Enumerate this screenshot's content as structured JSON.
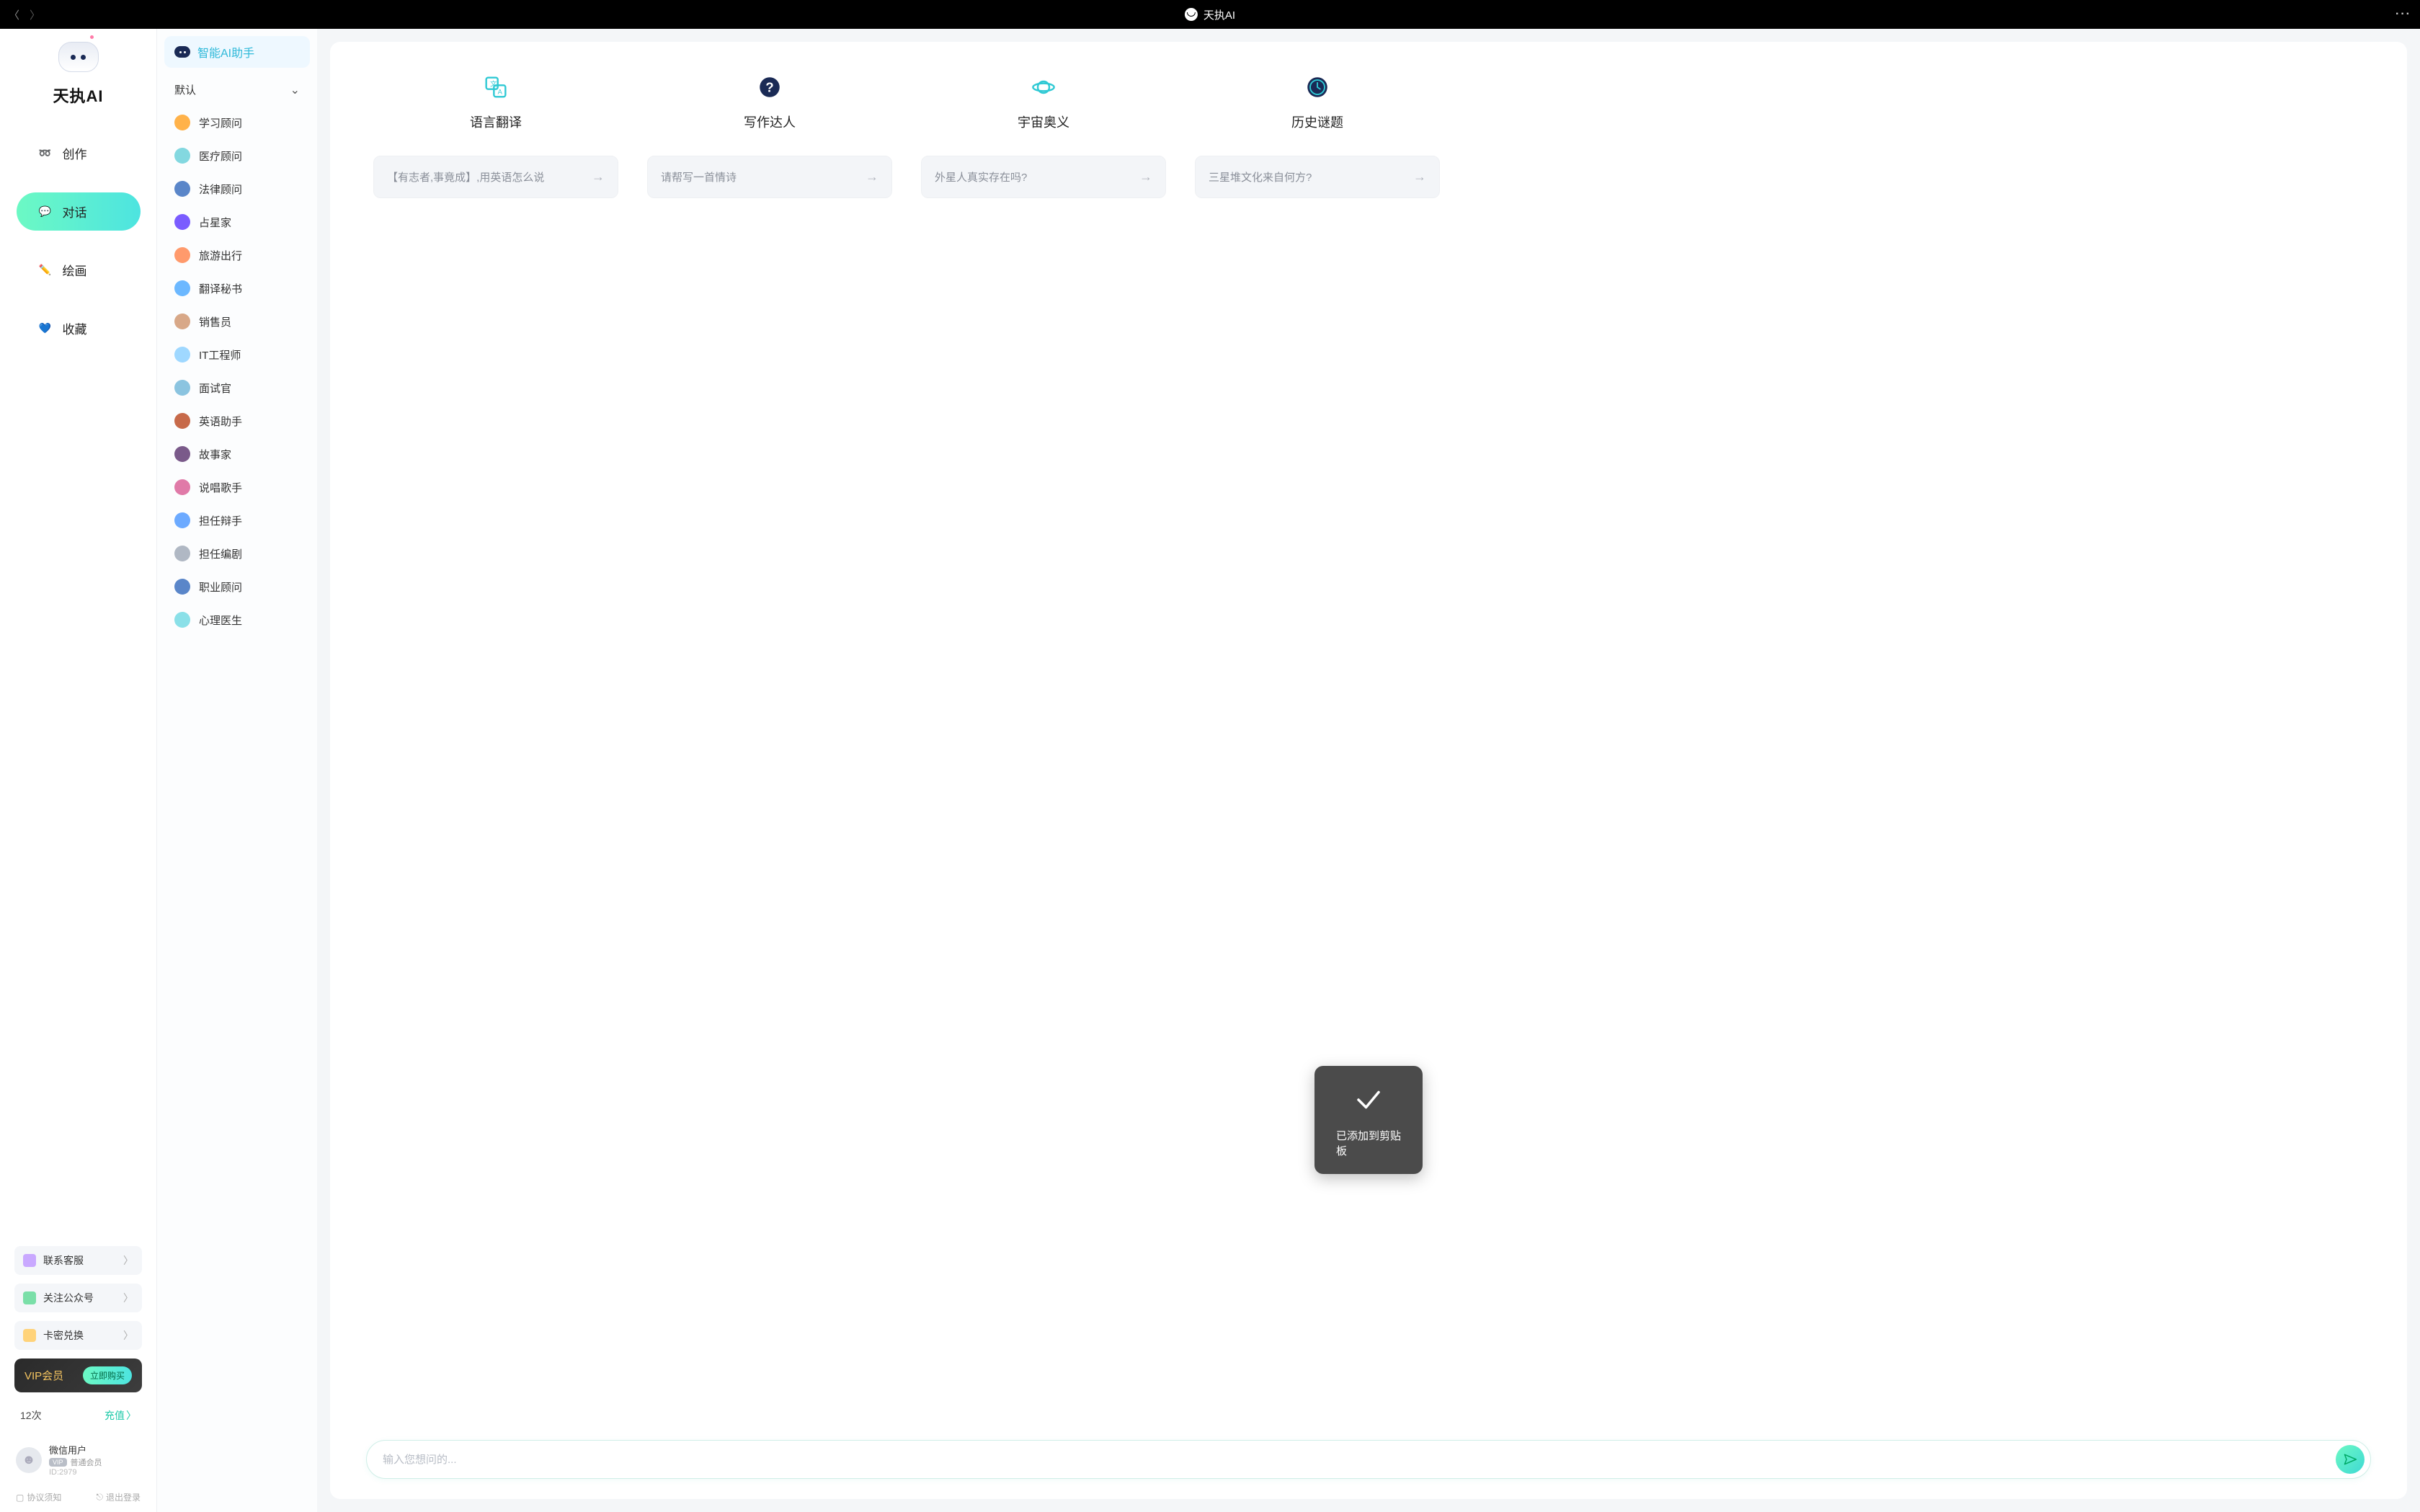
{
  "topbar": {
    "title": "天执AI"
  },
  "sidebar1": {
    "appName": "天执AI",
    "nav": [
      {
        "label": "创作",
        "icon": "➿"
      },
      {
        "label": "对话",
        "icon": "💬",
        "active": true
      },
      {
        "label": "绘画",
        "icon": "✏️"
      },
      {
        "label": "收藏",
        "icon": "💙"
      }
    ],
    "actions": [
      {
        "label": "联系客服",
        "color": "#c9a8ff"
      },
      {
        "label": "关注公众号",
        "color": "#7adfa8"
      },
      {
        "label": "卡密兑换",
        "color": "#ffd37a"
      }
    ],
    "vip": {
      "label": "VIP会员",
      "btn": "立即购买"
    },
    "credit": {
      "count": "12次",
      "recharge": "充值"
    },
    "user": {
      "name": "微信用户",
      "badge": "VIP",
      "tier": "普通会员",
      "id": "ID:2979"
    },
    "bottom": {
      "agreement": "协议须知",
      "logout": "退出登录"
    }
  },
  "sidebar2": {
    "header": "智能AI助手",
    "default": "默认",
    "roles": [
      {
        "label": "学习顾问",
        "bg": "#ffb24a"
      },
      {
        "label": "医疗顾问",
        "bg": "#83d8e0"
      },
      {
        "label": "法律顾问",
        "bg": "#5a86c9"
      },
      {
        "label": "占星家",
        "bg": "#7a5cff"
      },
      {
        "label": "旅游出行",
        "bg": "#ff9a6c"
      },
      {
        "label": "翻译秘书",
        "bg": "#6cb8ff"
      },
      {
        "label": "销售员",
        "bg": "#d8a888"
      },
      {
        "label": "IT工程师",
        "bg": "#9fd8ff"
      },
      {
        "label": "面试官",
        "bg": "#8bc4e0"
      },
      {
        "label": "英语助手",
        "bg": "#c76a4a"
      },
      {
        "label": "故事家",
        "bg": "#7a5a8a"
      },
      {
        "label": "说唱歌手",
        "bg": "#e07aa8"
      },
      {
        "label": "担任辩手",
        "bg": "#6caaff"
      },
      {
        "label": "担任编剧",
        "bg": "#b0b8c4"
      },
      {
        "label": "职业顾问",
        "bg": "#5a86c9"
      },
      {
        "label": "心理医生",
        "bg": "#8ae0e8"
      }
    ]
  },
  "main": {
    "cards": [
      {
        "title": "语言翻译",
        "query": "【有志者,事竟成】,用英语怎么说",
        "iconColor": "#2fc9d4",
        "iconType": "translate"
      },
      {
        "title": "写作达人",
        "query": "请帮写一首情诗",
        "iconColor": "#1a2a55",
        "iconType": "question"
      },
      {
        "title": "宇宙奥义",
        "query": "外星人真实存在吗?",
        "iconColor": "#2fc9d4",
        "iconType": "cosmos"
      },
      {
        "title": "历史谜题",
        "query": "三星堆文化来自何方?",
        "iconColor": "#1a2a55",
        "iconType": "clock"
      }
    ],
    "toast": "已添加到剪贴板",
    "inputPlaceholder": "输入您想问的..."
  }
}
